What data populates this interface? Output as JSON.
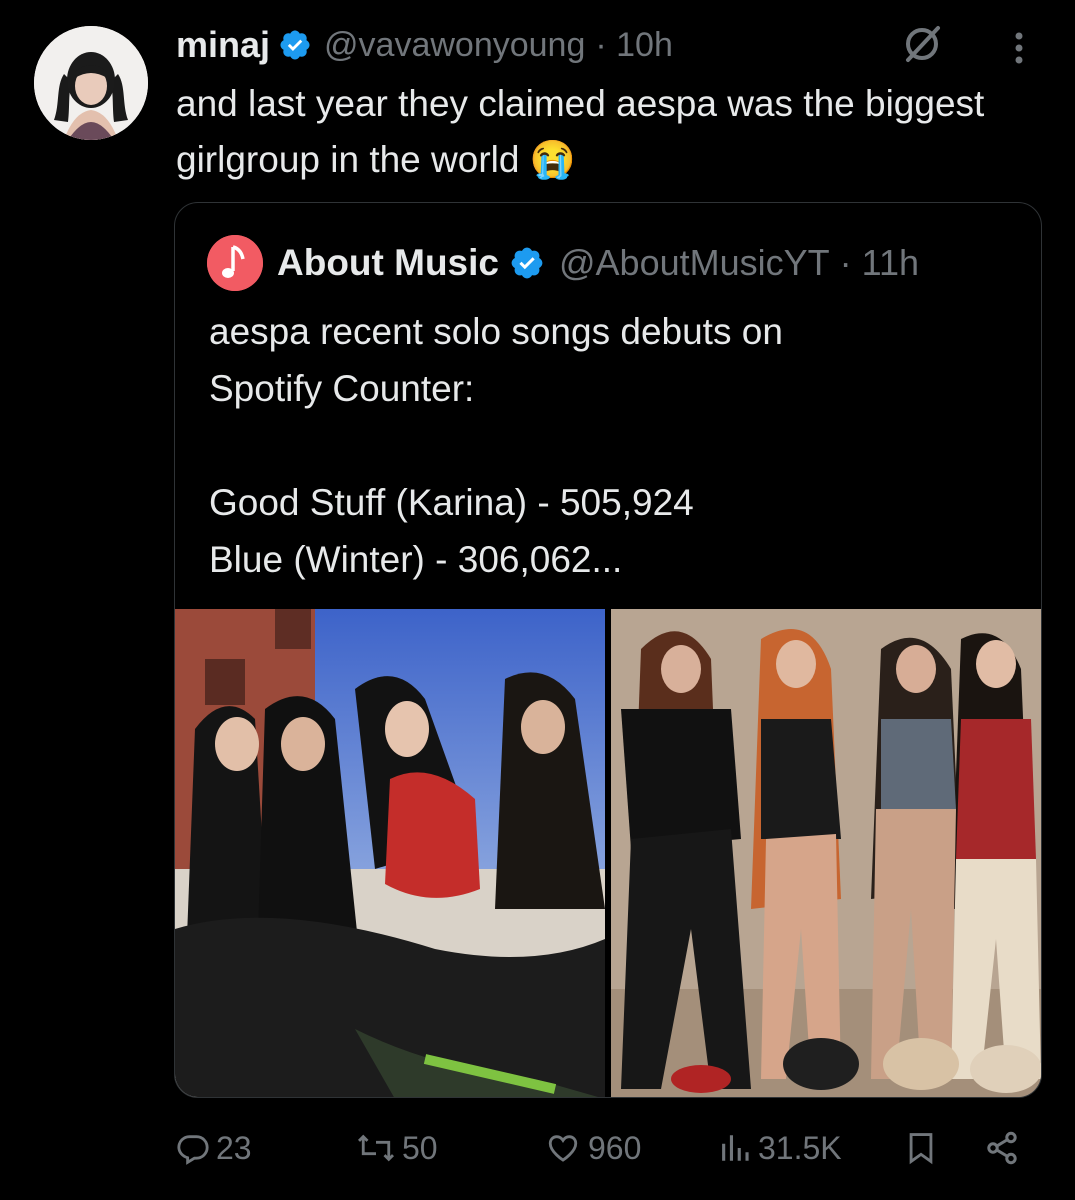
{
  "tweet": {
    "author": {
      "name": "minaj",
      "handle": "@vavawonyoung",
      "time": "· 10h",
      "verified": true
    },
    "text": "and last year they claimed aespa was the biggest girlgroup in the world 😭"
  },
  "quote": {
    "author": {
      "name": "About Music",
      "handle": "@AboutMusicYT",
      "time": "· 11h",
      "verified": true
    },
    "text_lines": [
      "aespa recent solo songs debuts on",
      "Spotify Counter:",
      "",
      "Good Stuff (Karina) - 505,924",
      "Blue (Winter) - 306,062..."
    ]
  },
  "actions": {
    "replies": "23",
    "reposts": "50",
    "likes": "960",
    "views": "31.5K"
  },
  "icons": {
    "verified_badge": "verified-check-icon",
    "grok": "grok-icon",
    "more": "more-vertical-icon",
    "reply": "reply-icon",
    "repost": "repost-icon",
    "like": "heart-icon",
    "views": "views-bar-icon",
    "bookmark": "bookmark-icon",
    "share": "share-icon"
  },
  "colors": {
    "background": "#000000",
    "text": "#e7e9ea",
    "secondary": "#71767b",
    "verified": "#1d9bf0",
    "border": "#2f3336"
  }
}
